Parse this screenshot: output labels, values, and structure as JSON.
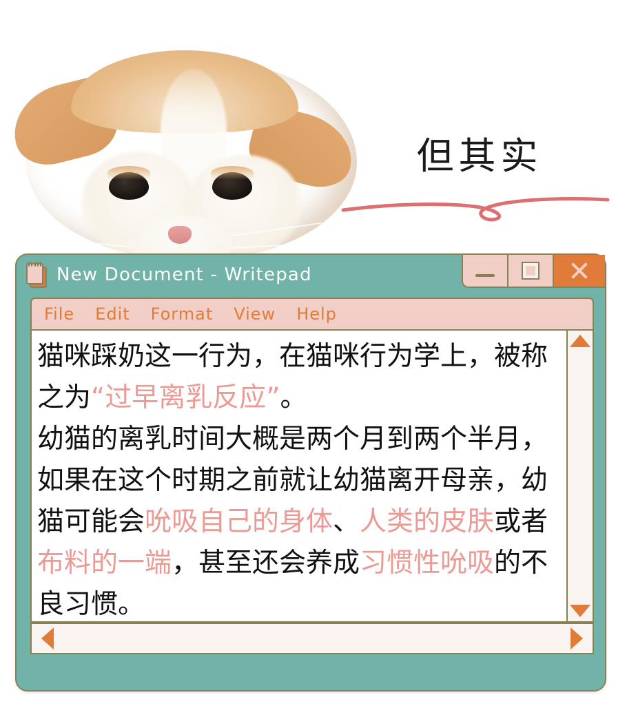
{
  "meme": {
    "caption": "但其实",
    "caption_color": "#1a1a1a",
    "swash_color": "#dd6f72",
    "image_alt": "sad-orange-white-cat-flat-ears"
  },
  "window": {
    "title": "New Document - Writepad",
    "icon": "notepad-icon",
    "frame_color": "#71b3a8",
    "border_color": "#8a8055",
    "accent_orange": "#e07b39",
    "accent_pink": "#f2cfc6",
    "controls": {
      "minimize": "—",
      "maximize": "❐",
      "close": "✕"
    },
    "menu": [
      {
        "label": "File"
      },
      {
        "label": "Edit"
      },
      {
        "label": "Format"
      },
      {
        "label": "View"
      },
      {
        "label": "Help"
      }
    ],
    "document": {
      "highlight_color": "#eb9a94",
      "text_color": "#111111",
      "segments": [
        {
          "text": "猫咪踩奶这一行为，在猫咪行为学上，被称之为",
          "highlight": false
        },
        {
          "text": "“过早离乳反应”",
          "highlight": true
        },
        {
          "text": "。\n",
          "highlight": false
        },
        {
          "text": "幼猫的离乳时间大概是两个月到两个半月，如果在这个时期之前就让幼猫离开母亲，幼猫可能会",
          "highlight": false
        },
        {
          "text": "吮吸自己的身体",
          "highlight": true
        },
        {
          "text": "、",
          "highlight": false
        },
        {
          "text": "人类的皮肤",
          "highlight": true
        },
        {
          "text": "或者",
          "highlight": false
        },
        {
          "text": "布料的一端",
          "highlight": true
        },
        {
          "text": "，甚至还会养成",
          "highlight": false
        },
        {
          "text": "习惯性吮吸",
          "highlight": true
        },
        {
          "text": "的不良习惯。",
          "highlight": false
        }
      ]
    },
    "scrollbars": {
      "vertical": {
        "up": "scroll-up-arrow",
        "down": "scroll-down-arrow"
      },
      "horizontal": {
        "left": "scroll-left-arrow",
        "right": "scroll-right-arrow"
      }
    }
  }
}
